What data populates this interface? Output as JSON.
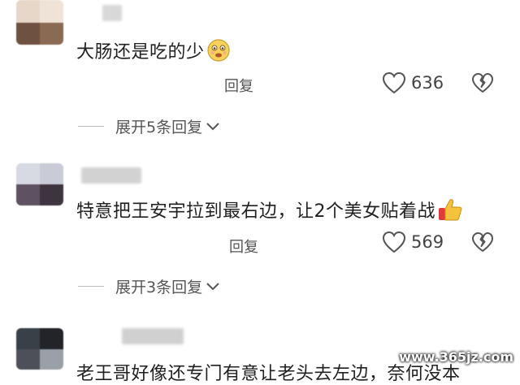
{
  "comments": [
    {
      "text": "大肠还是吃的少",
      "emoji": "smiling-face-emoji",
      "reply_label": "回复",
      "likes": "636",
      "expand_label": "展开5条回复"
    },
    {
      "text": "特意把王安宇拉到最右边，让2个美女贴着战",
      "emoji": "thumbs-up-emoji",
      "reply_label": "回复",
      "likes": "569",
      "expand_label": "展开3条回复"
    },
    {
      "text": "老王哥好像还专门有意让老头去左边，奈何没本"
    }
  ],
  "watermark": "www.365jz.com",
  "icons": {
    "like": "heart-outline-icon",
    "dislike": "broken-heart-icon",
    "expand": "chevron-down-icon"
  },
  "colors": {
    "text": "#1f1f1f",
    "secondary": "#555555",
    "icon": "#555555"
  }
}
